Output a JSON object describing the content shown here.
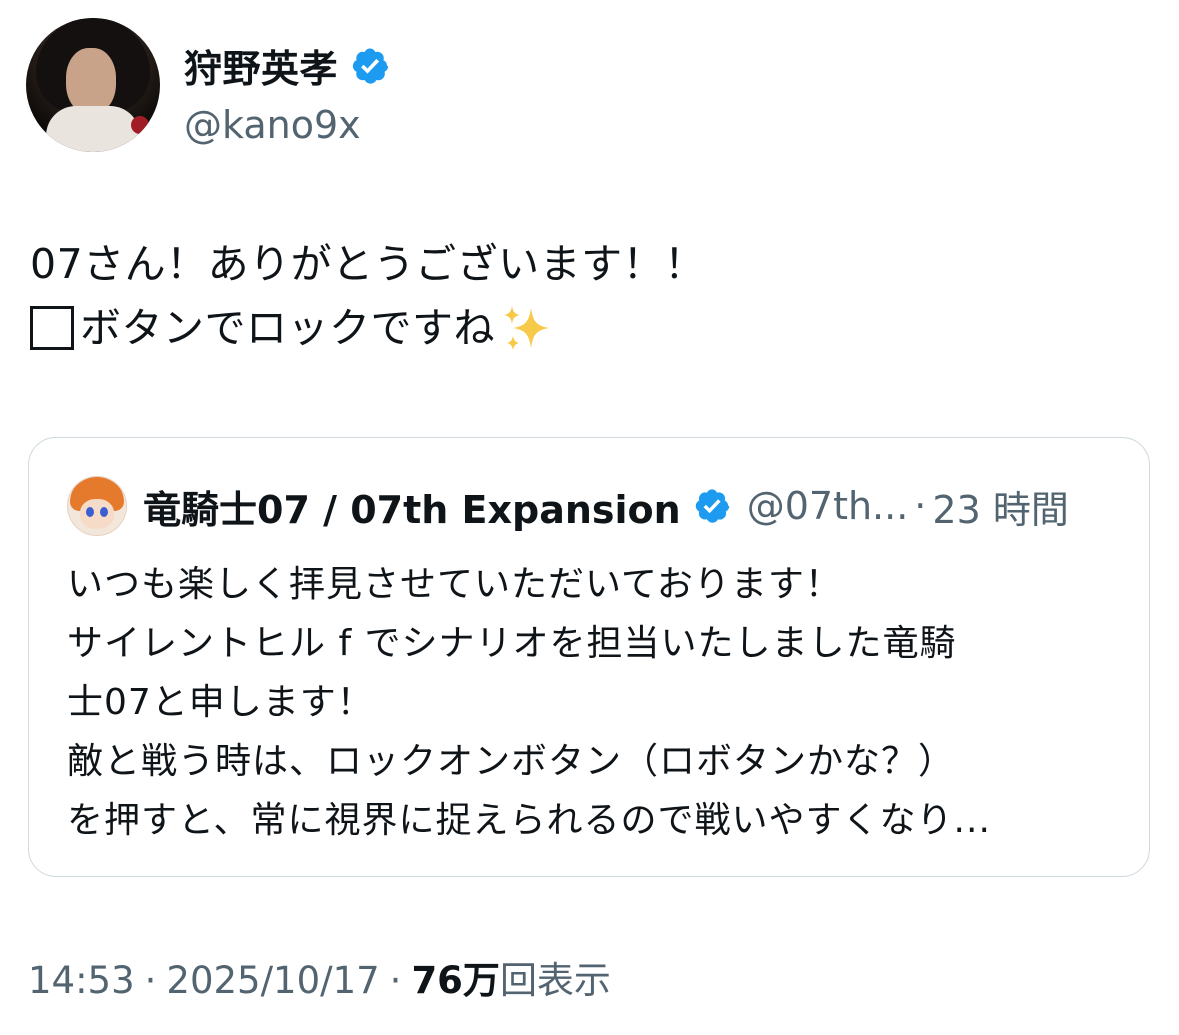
{
  "author": {
    "display_name": "狩野英孝",
    "handle": "@kano9x",
    "verified_color": "#1d9bf0"
  },
  "tweet": {
    "line1": "07さん！ありがとうございます！！",
    "line2": "ボタンでロックですね",
    "line2_leading_icon": "square-button-glyph",
    "line2_trailing_icon": "sparkles-emoji"
  },
  "quote": {
    "display_name": "竜騎士07 / 07th Expansion",
    "handle": "@07th...",
    "separator": "·",
    "time": "23 時間",
    "lines": [
      "いつも楽しく拝見させていただいております！",
      "サイレントヒル f でシナリオを担当いたしました竜騎",
      "士07と申します！",
      "敵と戦う時は、ロックオンボタン（ロボタンかな？）",
      "を押すと、常に視界に捉えられるので戦いやすくなり..."
    ]
  },
  "meta": {
    "time": "14:53",
    "separator": "·",
    "date": "2025/10/17",
    "views_count": "76万",
    "views_label": "回表示"
  },
  "colors": {
    "text_primary": "#0f1419",
    "text_secondary": "#536471",
    "border": "#cfd9de",
    "verified": "#1d9bf0"
  }
}
